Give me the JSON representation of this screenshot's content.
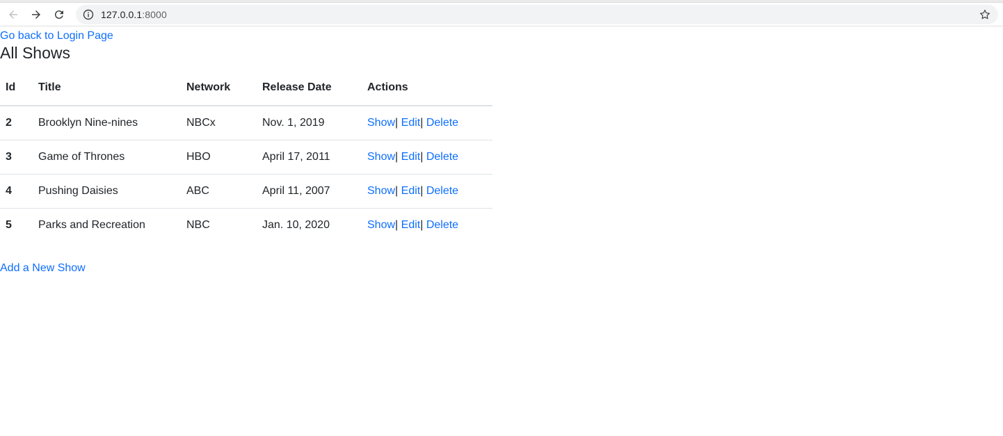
{
  "browser": {
    "url_host": "127.0.0.1",
    "url_port": ":8000"
  },
  "page": {
    "back_link": "Go back to Login Page",
    "title": "All Shows",
    "add_link": "Add a New Show"
  },
  "table": {
    "headers": [
      "Id",
      "Title",
      "Network",
      "Release Date",
      "Actions"
    ],
    "rows": [
      {
        "id": "2",
        "title": "Brooklyn Nine-nines",
        "network": "NBCx",
        "release_date": "Nov. 1, 2019"
      },
      {
        "id": "3",
        "title": "Game of Thrones",
        "network": "HBO",
        "release_date": "April 17, 2011"
      },
      {
        "id": "4",
        "title": "Pushing Daisies",
        "network": "ABC",
        "release_date": "April 11, 2007"
      },
      {
        "id": "5",
        "title": "Parks and Recreation",
        "network": "NBC",
        "release_date": "Jan. 10, 2020"
      }
    ],
    "actions": {
      "show": "Show",
      "edit": "Edit",
      "delete": "Delete",
      "separator": "|"
    }
  },
  "colors": {
    "link": "#0d6efd",
    "text": "#212529",
    "border": "#dee2e6"
  }
}
